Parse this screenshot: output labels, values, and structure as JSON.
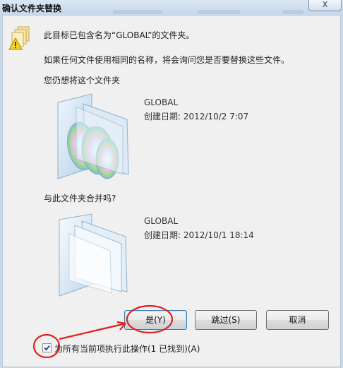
{
  "window": {
    "title": "确认文件夹替换",
    "close_glyph": "X"
  },
  "dialog": {
    "line1": "此目标已包含名为“GLOBAL”的文件夹。",
    "line2": "如果任何文件使用相同的名称，将会询问您是否要替换这些文件。",
    "line3": "您仍想将这个文件夹",
    "line4": "与此文件夹合并吗?",
    "source": {
      "name": "GLOBAL",
      "date": "创建日期: 2012/10/2 7:07"
    },
    "target": {
      "name": "GLOBAL",
      "date": "创建日期: 2012/10/1 18:14"
    }
  },
  "buttons": {
    "yes": "是(Y)",
    "skip": "跳过(S)",
    "cancel": "取消"
  },
  "apply_all": {
    "label": "为所有当前项执行此操作(1 已找到)(A)",
    "checked": true
  },
  "icons": {
    "warning": "warning-folder-icon",
    "source_folder": "folder-with-discs-icon",
    "target_folder": "folder-icon"
  },
  "colors": {
    "annotation": "#e02020",
    "dialog_bg": "#f0f0f0"
  }
}
